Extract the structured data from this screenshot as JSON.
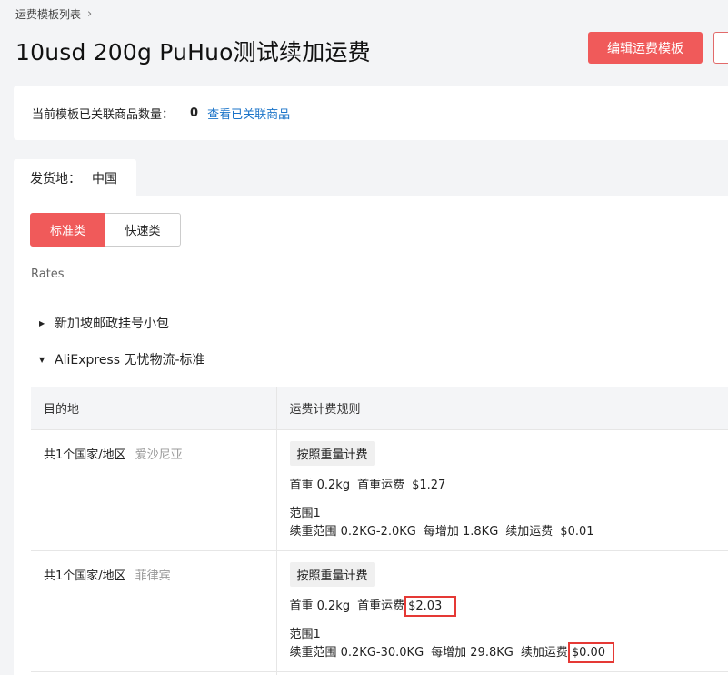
{
  "breadcrumb": {
    "text": "运费模板列表",
    "chevron": "›"
  },
  "page": {
    "title": "10usd 200g PuHuo测试续加运费",
    "edit_button": "编辑运费模板"
  },
  "summary": {
    "label": "当前模板已关联商品数量：",
    "count": "0",
    "link": "查看已关联商品"
  },
  "origin_tab": {
    "label": "发货地：",
    "value": "中国"
  },
  "segment": {
    "standard": "标准类",
    "express": "快速类"
  },
  "rates_label": "Rates",
  "carriers": [
    {
      "name": "新加坡邮政挂号小包",
      "expanded": false
    },
    {
      "name": "AliExpress 无忧物流-标准",
      "expanded": true
    }
  ],
  "table": {
    "headers": {
      "destination": "目的地",
      "rule": "运费计费规则"
    },
    "rows": [
      {
        "dest_count": "共1个国家/地区",
        "dest_country": "爱沙尼亚",
        "method": "按照重量计费",
        "first_weight": "首重 0.2kg",
        "first_fee_label": "首重运费",
        "first_fee": "$1.27",
        "range_title": "范围1",
        "range_scope": "续重范围 0.2KG-2.0KG",
        "step": "每增加 1.8KG",
        "extra_fee_label": "续加运费",
        "extra_fee": "$0.01"
      },
      {
        "dest_count": "共1个国家/地区",
        "dest_country": "菲律宾",
        "method": "按照重量计费",
        "first_weight": "首重 0.2kg",
        "first_fee_label": "首重运费",
        "first_fee": "$2.03",
        "range_title": "范围1",
        "range_scope": "续重范围 0.2KG-30.0KG",
        "step": "每增加 29.8KG",
        "extra_fee_label": "续加运费",
        "extra_fee": "$0.00"
      }
    ]
  },
  "colors": {
    "accent": "#f05a5a",
    "link": "#1a73c8",
    "highlight": "#e53935"
  }
}
